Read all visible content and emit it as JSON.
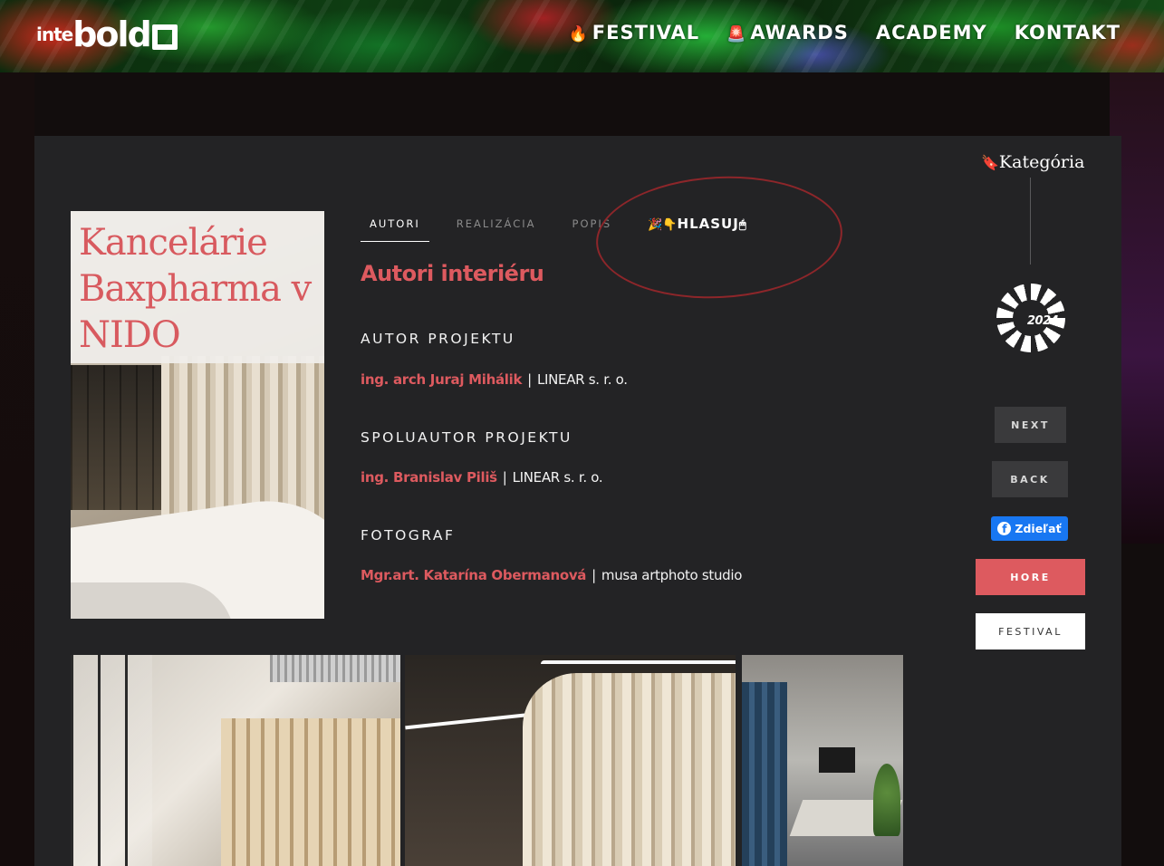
{
  "header": {
    "logo": {
      "main": "intebold",
      "prefix": "inte",
      "word": "bold"
    },
    "nav": [
      {
        "emoji": "🔥",
        "label": "FESTIVAL"
      },
      {
        "emoji": "🚨",
        "label": "AWARDS"
      },
      {
        "emoji": "",
        "label": "ACADEMY"
      },
      {
        "emoji": "",
        "label": "KONTAKT"
      }
    ]
  },
  "project": {
    "title": "Kancelárie Baxpharma v NIDO"
  },
  "tabs": [
    {
      "label": "AUTORI",
      "active": true
    },
    {
      "label": "REALIZÁCIA",
      "active": false
    },
    {
      "label": "POPIS",
      "active": false
    },
    {
      "label": "HLASUJ",
      "prefix_emoji": "🎉👇",
      "suffix_emoji": "🖱"
    }
  ],
  "authors": {
    "heading": "Autori interiéru",
    "credits": [
      {
        "role": "AUTOR PROJEKTU",
        "person": "ing. arch Juraj Mihálik",
        "company": "LINEAR s. r. o."
      },
      {
        "role": "SPOLUAUTOR PROJEKTU",
        "person": "ing. Branislav Piliš",
        "company": "LINEAR s. r. o."
      },
      {
        "role": "FOTOGRAF",
        "person": "Mgr.art. Katarína Obermanová",
        "company": "musa artphoto studio"
      }
    ]
  },
  "sidebar": {
    "category_emoji": "🔖",
    "category_label": "Kategória",
    "badge_year": "2024",
    "next": "NEXT",
    "back": "BACK",
    "share": "Zdieľať",
    "up": "HORE",
    "festival": "FESTIVAL"
  },
  "colors": {
    "accent": "#dd5a5f",
    "card_bg": "#232325",
    "facebook": "#1877f2",
    "page_bg": "#120d0d"
  }
}
